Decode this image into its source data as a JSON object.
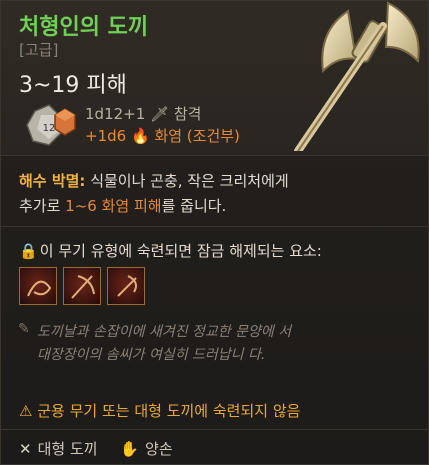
{
  "item": {
    "name": "처형인의 도끼",
    "rarity": "[고급]",
    "damage_range": "3~19 피해",
    "dice_label": "12",
    "damage_base": "1d12+1",
    "damage_base_type": "참격",
    "damage_bonus": "+1d6",
    "damage_bonus_type": "화염 (조건부)"
  },
  "effect": {
    "keyword": "해수 박멸:",
    "text_1": " 식물이나 곤충, 작은 크리처에게",
    "text_2_pre": "추가로 ",
    "text_2_hl": "1~6 화염 피해",
    "text_2_post": "를 줍니다."
  },
  "unlock": {
    "label": "이 무기 유형에 숙련되면 잠금 해제되는 요소:"
  },
  "lore": {
    "text": "도끼날과 손잡이에 새겨진 정교한 문양에 서 대장장이의 솜씨가 여실히 드러납니 다."
  },
  "warning": {
    "text": "군용 무기 또는 대형 도끼에 숙련되지 않음"
  },
  "properties": [
    {
      "icon": "crossed-axes-icon",
      "label": "대형 도끼"
    },
    {
      "icon": "hand-icon",
      "label": "양손"
    }
  ],
  "colors": {
    "name": "#6fd056",
    "rarity": "#8c8277",
    "keyword": "#f2b245",
    "fire": "#e58a3d",
    "warning": "#e8a93a"
  }
}
